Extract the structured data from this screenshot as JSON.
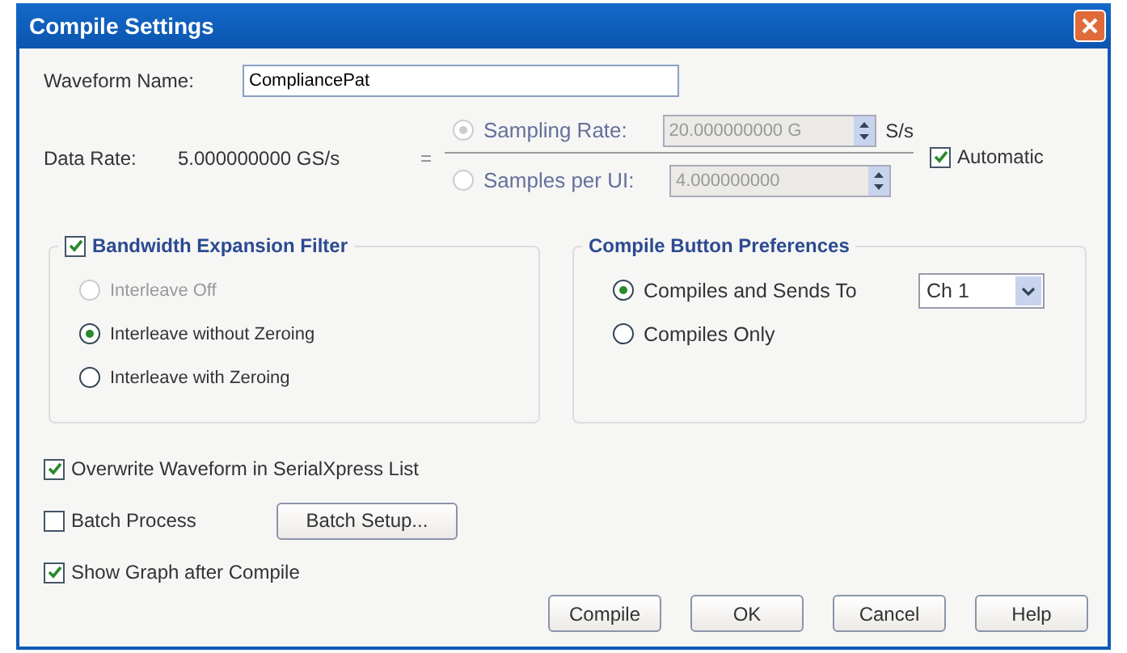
{
  "window": {
    "title": "Compile Settings"
  },
  "waveform_name": {
    "label": "Waveform Name:",
    "value": "CompliancePat"
  },
  "data_rate": {
    "label": "Data Rate:",
    "value": "5.000000000 GS/s",
    "equals": "=",
    "options": [
      {
        "label": "Sampling Rate:",
        "selected": true,
        "disabled": true,
        "value": "20.000000000 G",
        "unit": "S/s"
      },
      {
        "label": "Samples per UI:",
        "selected": false,
        "disabled": true,
        "value": "4.000000000"
      }
    ],
    "automatic": {
      "label": "Automatic",
      "checked": true
    }
  },
  "bandwidth_filter": {
    "label": "Bandwidth Expansion Filter",
    "checked": true,
    "options": [
      {
        "label": "Interleave Off",
        "selected": false,
        "disabled": true
      },
      {
        "label": "Interleave without Zeroing",
        "selected": true,
        "disabled": false
      },
      {
        "label": "Interleave with Zeroing",
        "selected": false,
        "disabled": false
      }
    ]
  },
  "compile_preferences": {
    "title": "Compile Button Preferences",
    "channel": "Ch 1",
    "options": [
      {
        "label": "Compiles and Sends To",
        "selected": true
      },
      {
        "label": "Compiles Only",
        "selected": false
      }
    ]
  },
  "checkboxes": [
    {
      "label": "Overwrite Waveform in SerialXpress List",
      "checked": true
    },
    {
      "label": "Batch Process",
      "checked": false,
      "button": "Batch Setup..."
    },
    {
      "label": "Show Graph after Compile",
      "checked": true
    }
  ],
  "buttons": [
    "Compile",
    "OK",
    "Cancel",
    "Help"
  ]
}
